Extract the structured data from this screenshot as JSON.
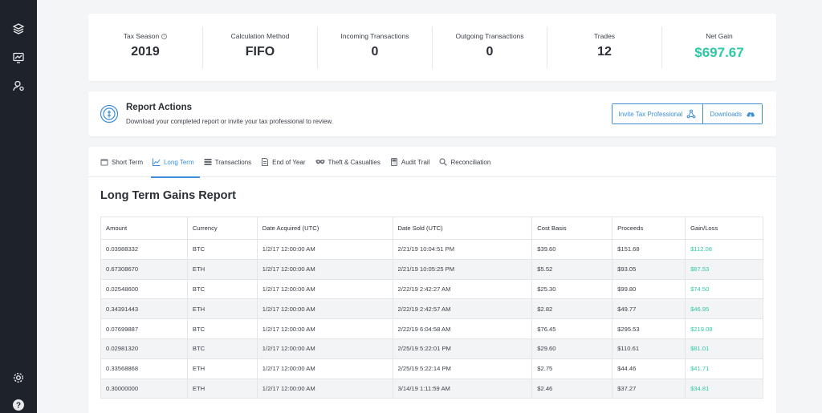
{
  "sidebar": {
    "icons": [
      "layers-icon",
      "dashboard-monitor-icon",
      "user-settings-icon",
      "gear-icon",
      "help-icon"
    ]
  },
  "stats": {
    "tax_season": {
      "label": "Tax Season",
      "value": "2019"
    },
    "calc_method": {
      "label": "Calculation Method",
      "value": "FIFO"
    },
    "incoming": {
      "label": "Incoming Transactions",
      "value": "0"
    },
    "outgoing": {
      "label": "Outgoing Transactions",
      "value": "0"
    },
    "trades": {
      "label": "Trades",
      "value": "12"
    },
    "net_gain": {
      "label": "Net Gain",
      "value": "$697.67"
    }
  },
  "report_actions": {
    "title": "Report Actions",
    "subtitle": "Download your completed report or invite your tax professional to review.",
    "invite_label": "Invite Tax Professional",
    "downloads_label": "Downloads"
  },
  "tabs": [
    {
      "label": "Short Term"
    },
    {
      "label": "Long Term"
    },
    {
      "label": "Transactions"
    },
    {
      "label": "End of Year"
    },
    {
      "label": "Theft & Casualties"
    },
    {
      "label": "Audit Trail"
    },
    {
      "label": "Reconciliation"
    }
  ],
  "report": {
    "title": "Long Term Gains Report",
    "columns": [
      "Amount",
      "Currency",
      "Date Acquired (UTC)",
      "Date Sold (UTC)",
      "Cost Basis",
      "Proceeds",
      "Gain/Loss"
    ],
    "rows": [
      [
        "0.03988332",
        "BTC",
        "1/2/17 12:00:00 AM",
        "2/21/19 10:04:51 PM",
        "$39.60",
        "$151.68",
        "$112.08"
      ],
      [
        "0.67308670",
        "ETH",
        "1/2/17 12:00:00 AM",
        "2/21/19 10:05:25 PM",
        "$5.52",
        "$93.05",
        "$87.53"
      ],
      [
        "0.02548600",
        "BTC",
        "1/2/17 12:00:00 AM",
        "2/22/19 2:42:27 AM",
        "$25.30",
        "$99.80",
        "$74.50"
      ],
      [
        "0.34391443",
        "ETH",
        "1/2/17 12:00:00 AM",
        "2/22/19 2:42:57 AM",
        "$2.82",
        "$49.77",
        "$46.95"
      ],
      [
        "0.07699887",
        "BTC",
        "1/2/17 12:00:00 AM",
        "2/22/19 6:04:58 AM",
        "$76.45",
        "$295.53",
        "$219.08"
      ],
      [
        "0.02981320",
        "BTC",
        "1/2/17 12:00:00 AM",
        "2/25/19 5:22:01 PM",
        "$29.60",
        "$110.61",
        "$81.01"
      ],
      [
        "0.33568868",
        "ETH",
        "1/2/17 12:00:00 AM",
        "2/25/19 5:22:14 PM",
        "$2.75",
        "$44.46",
        "$41.71"
      ],
      [
        "0.30000000",
        "ETH",
        "1/2/17 12:00:00 AM",
        "3/14/19 1:11:59 AM",
        "$2.46",
        "$37.27",
        "$34.81"
      ]
    ]
  },
  "colors": {
    "accent": "#3b8fd9",
    "gain": "#2fc7a6",
    "sidebar": "#1d222b"
  }
}
